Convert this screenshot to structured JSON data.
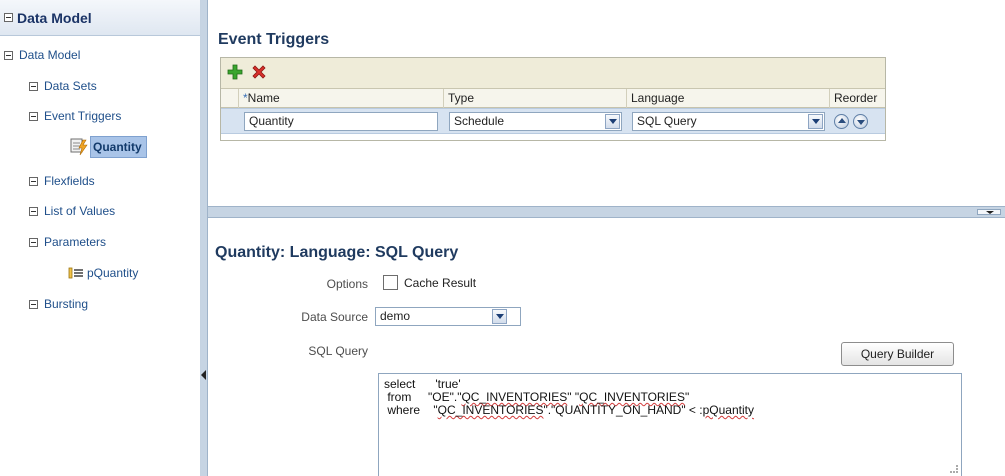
{
  "left_panel": {
    "header_title": "Data Model",
    "tree_root": "Data Model",
    "items": [
      {
        "label": "Data Sets"
      },
      {
        "label": "Event Triggers"
      },
      {
        "label": "Flexfields"
      },
      {
        "label": "List of Values"
      },
      {
        "label": "Parameters"
      },
      {
        "label": "Bursting"
      }
    ],
    "selected_trigger": "Quantity",
    "parameter_child": "pQuantity"
  },
  "event_triggers": {
    "title": "Event Triggers",
    "columns": {
      "required_mark": "*",
      "name": "Name",
      "type": "Type",
      "language": "Language",
      "reorder": "Reorder"
    },
    "row": {
      "name": "Quantity",
      "type": "Schedule",
      "language": "SQL Query"
    },
    "add_icon": "green-plus-icon",
    "delete_icon": "red-x-icon"
  },
  "detail": {
    "title": "Quantity: Language: SQL Query",
    "options_label": "Options",
    "cache_result_label": "Cache Result",
    "cache_result_checked": false,
    "data_source_label": "Data Source",
    "data_source_value": "demo",
    "sql_query_label": "SQL Query",
    "query_builder_label": "Query Builder",
    "sql": {
      "line1_kw": "select",
      "line1_val": "'true'",
      "line2_kw": "from",
      "line2_val_a": "\"OE\".\"",
      "line2_val_b": "QC_INVENTORIES",
      "line2_val_c": "\" \"",
      "line2_val_d": "QC_INVENTORIES",
      "line2_val_e": "\"",
      "line3_kw": "where",
      "line3_val_a": "\"",
      "line3_val_b": "QC_INVENTORIES",
      "line3_val_c": "\".\"QUANTITY_ON_HAND\" < :",
      "line3_val_d": "pQuantity"
    }
  },
  "colors": {
    "accent": "#1f4f8a",
    "selection": "#a9c4e8",
    "toolbar": "#efecd9"
  }
}
